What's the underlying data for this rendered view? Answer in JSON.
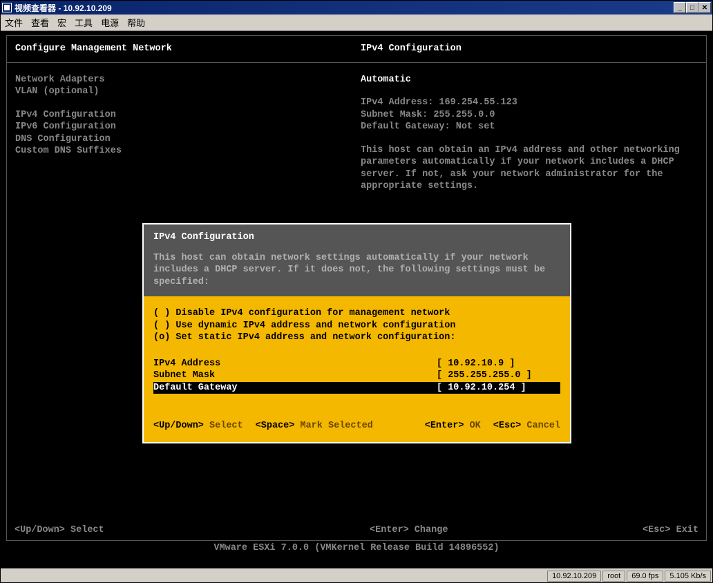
{
  "window": {
    "title": "视频查看器 - 10.92.10.209"
  },
  "menubar": [
    "文件",
    "查看",
    "宏",
    "工具",
    "电源",
    "帮助"
  ],
  "panel": {
    "left_title": "Configure Management Network",
    "right_title": "IPv4 Configuration",
    "left_items": {
      "net_adapters": "Network Adapters",
      "vlan": "VLAN (optional)",
      "ipv4": "IPv4 Configuration",
      "ipv6": "IPv6 Configuration",
      "dns": "DNS Configuration",
      "suffixes": "Custom DNS Suffixes"
    },
    "right_info": {
      "automatic": "Automatic",
      "ipv4_addr": "IPv4 Address: 169.254.55.123",
      "subnet": "Subnet Mask: 255.255.0.0",
      "gateway": "Default Gateway: Not set",
      "desc1": "This host can obtain an IPv4 address and other networking",
      "desc2": "parameters automatically if your network includes a DHCP",
      "desc3": "server. If not, ask your network administrator for the",
      "desc4": "appropriate settings."
    }
  },
  "dialog": {
    "title": "IPv4 Configuration",
    "desc1": "This host can obtain network settings automatically if your network",
    "desc2": "includes a DHCP server. If it does not, the following settings must be",
    "desc3": "specified:",
    "radios": {
      "disable": "( ) Disable IPv4 configuration for management network",
      "dynamic": "( ) Use dynamic IPv4 address and network configuration",
      "static": "(o) Set static IPv4 address and network configuration:"
    },
    "fields": {
      "ipv4_label": "IPv4 Address",
      "ipv4_value": "[ 10.92.10.9      ]",
      "subnet_label": "Subnet Mask",
      "subnet_value": "[ 255.255.255.0  ]",
      "gateway_label": "Default Gateway",
      "gateway_value": "[ 10.92.10.254   ]"
    },
    "footer": {
      "updown_key": "<Up/Down>",
      "updown_act": "Select",
      "space_key": "<Space>",
      "space_act": "Mark Selected",
      "enter_key": "<Enter>",
      "enter_act": "OK",
      "esc_key": "<Esc>",
      "esc_act": "Cancel"
    }
  },
  "bottom": {
    "left": "<Up/Down> Select",
    "mid": "<Enter> Change",
    "right": "<Esc> Exit"
  },
  "version": "VMware ESXi 7.0.0 (VMKernel Release Build 14896552)",
  "status": {
    "ip": "10.92.10.209",
    "user": "root",
    "fps": "69.0 fps",
    "bw": "5.105 Kb/s"
  }
}
